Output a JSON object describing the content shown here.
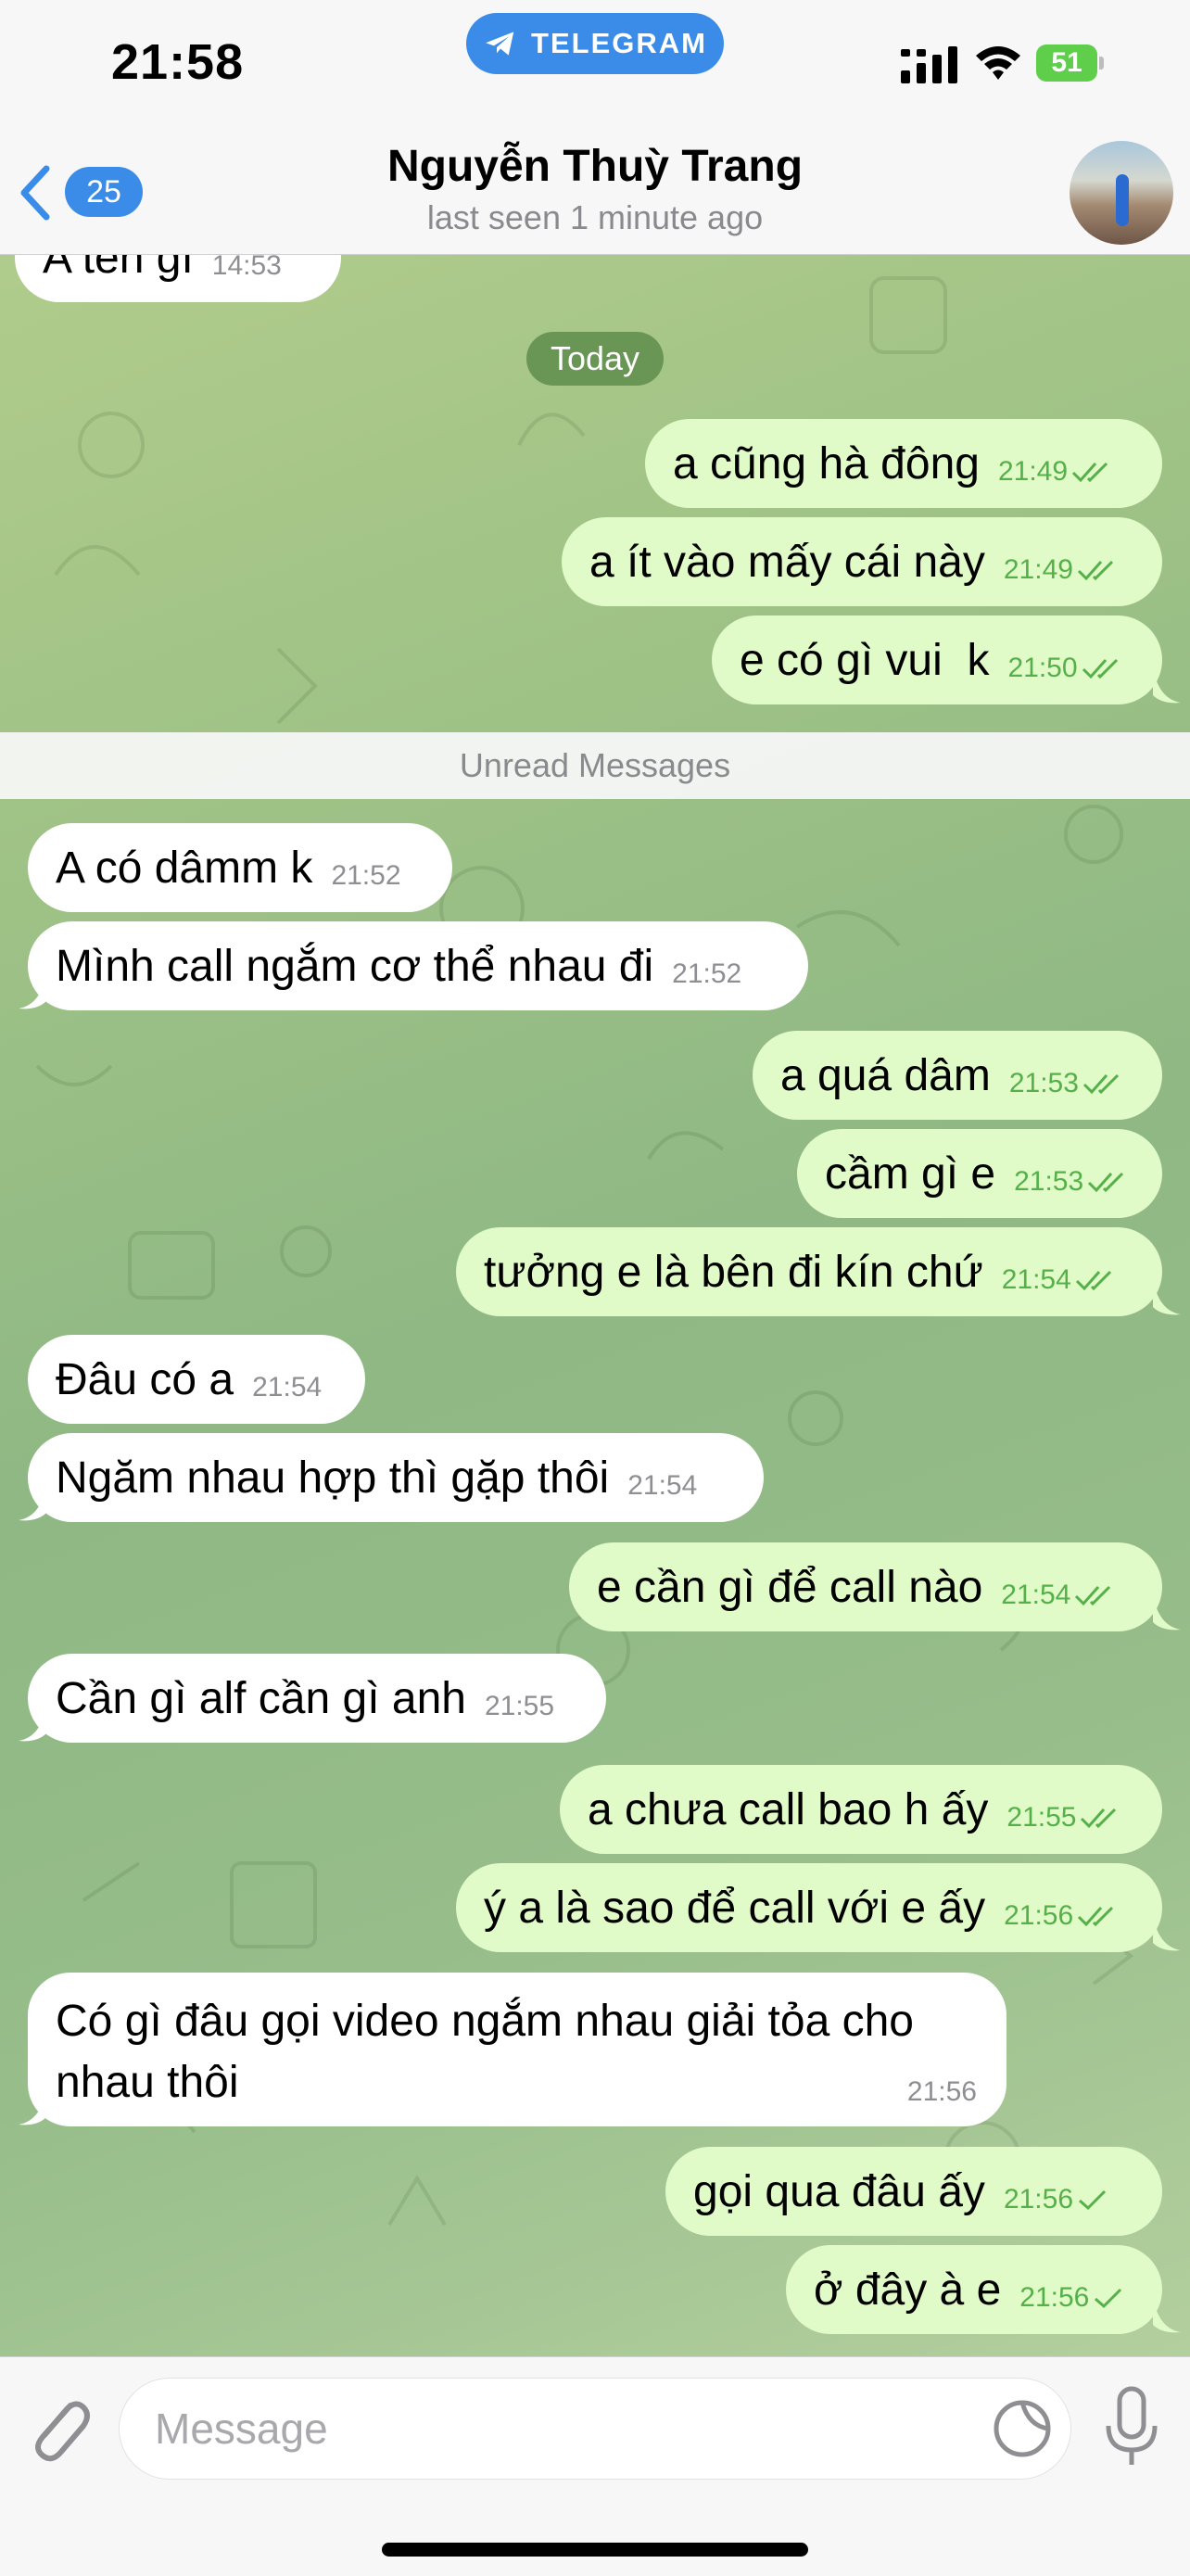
{
  "status_bar": {
    "time": "21:58",
    "app_pill": "TELEGRAM",
    "battery": "51"
  },
  "header": {
    "back_count": "25",
    "contact_name": "Nguyễn Thuỳ Trang",
    "last_seen": "last seen 1 minute ago"
  },
  "chat": {
    "date_separator": "Today",
    "unread_separator": "Unread Messages",
    "partial_message": {
      "text": "A tên gì",
      "time": "14:53"
    },
    "messages": [
      {
        "text": "a cũng hà đông",
        "time": "21:49"
      },
      {
        "text": "a ít vào mấy cái này",
        "time": "21:49"
      },
      {
        "text": "e có gì vui  k",
        "time": "21:50"
      },
      {
        "text": "A có dâmm k",
        "time": "21:52"
      },
      {
        "text": "Mình call ngắm cơ thể nhau đi",
        "time": "21:52"
      },
      {
        "text": "a quá dâm",
        "time": "21:53"
      },
      {
        "text": "cầm gì e",
        "time": "21:53"
      },
      {
        "text": "tưởng e là bên đi kín chứ",
        "time": "21:54"
      },
      {
        "text": "Đâu có a",
        "time": "21:54"
      },
      {
        "text": "Ngăm nhau hợp thì gặp thôi",
        "time": "21:54"
      },
      {
        "text": "e cần gì để call nào",
        "time": "21:54"
      },
      {
        "text": "Cần gì alf cần gì anh",
        "time": "21:55"
      },
      {
        "text": "a chưa call bao h ấy",
        "time": "21:55"
      },
      {
        "text": "ý a là sao để call với e ấy",
        "time": "21:56"
      },
      {
        "text": "Có gì đâu gọi video ngắm nhau giải tỏa cho nhau thôi",
        "time": "21:56"
      },
      {
        "text": "gọi qua đâu ấy",
        "time": "21:56"
      },
      {
        "text": "ở đây à e",
        "time": "21:56"
      }
    ]
  },
  "input": {
    "placeholder": "Message"
  },
  "icons": {
    "back": "chevron-left-icon",
    "attach": "paperclip-icon",
    "sticker": "sticker-icon",
    "mic": "microphone-icon",
    "read_receipt": "double-check-icon",
    "sent_receipt": "single-check-icon"
  },
  "colors": {
    "accent": "#3a8ce8",
    "outgoing_bubble": "#e0fac8",
    "incoming_bubble": "#ffffff",
    "outgoing_meta": "#56b04a",
    "chat_background": "#9cbd84"
  }
}
